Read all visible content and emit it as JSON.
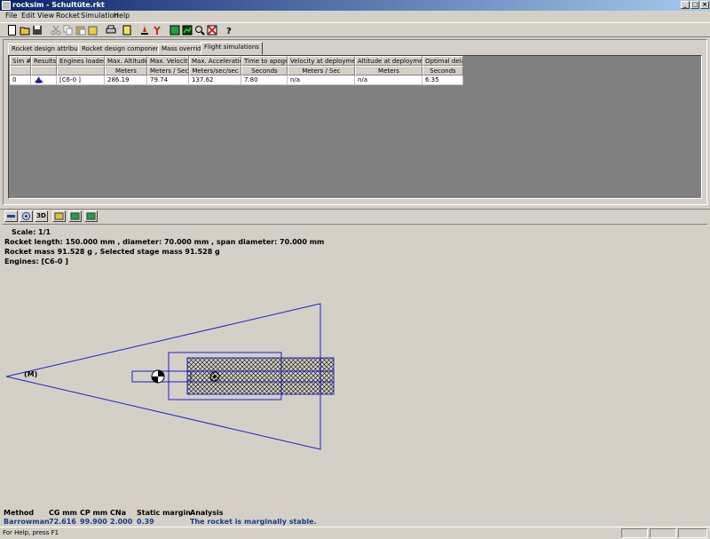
{
  "window": {
    "title": "rocksim - Schultüte.rkt"
  },
  "menu": [
    "File",
    "Edit",
    "View",
    "Rocket",
    "Simulation",
    "Help"
  ],
  "toolbar": {
    "buttons": [
      "new-icon",
      "open-icon",
      "save-icon",
      "cut-icon",
      "copy-icon",
      "paste-icon",
      "paste-special-icon",
      "print-icon",
      "properties-icon",
      "launch-icon",
      "engine-icon",
      "grid-icon",
      "chart-icon",
      "zoom-icon",
      "cancel-icon",
      "help-icon"
    ]
  },
  "tabs": [
    "Rocket design attributes",
    "Rocket design components",
    "Mass override",
    "Flight simulations"
  ],
  "active_tab": "Flight simulations",
  "table": {
    "headers": [
      "Sim #",
      "Results",
      "Engines loaded",
      "Max. Altitude",
      "Max. Velocity",
      "Max. Acceleration",
      "Time to apogee",
      "Velocity at deployment",
      "Altitude at deployment",
      "Optimal delay"
    ],
    "units": [
      "",
      "",
      "",
      "Meters",
      "Meters / Sec",
      "Meters/sec/sec",
      "Seconds",
      "Meters / Sec",
      "Meters",
      "Seconds"
    ],
    "rows": [
      [
        "0",
        "",
        "[C6-0   ]",
        "286.19",
        "79.74",
        "137.62",
        "7.80",
        "n/a",
        "n/a",
        "6.35"
      ]
    ]
  },
  "design_toolbar": {
    "labels": [
      "",
      "",
      "3D",
      "",
      "",
      ""
    ]
  },
  "design_info": {
    "scale": "Scale: 1/1",
    "length_line": "Rocket length: 150.000  mm , diameter: 70.000  mm , span diameter: 70.000  mm",
    "mass_line": "Rocket mass 91.528 g , Selected stage mass 91.528 g",
    "engines_line": "Engines: [C6-0   ]",
    "marker_label": "(M)"
  },
  "stability": {
    "headers": [
      "Method",
      "CG mm",
      "CP mm",
      "CNa",
      "Static margin",
      "Analysis"
    ],
    "values": [
      "Barrowman",
      "72.616",
      "99.900",
      "2.000",
      "0.39",
      "The rocket is marginally stable."
    ]
  },
  "status": {
    "text": "For Help, press F1"
  },
  "colors": {
    "outline": "#2020c0",
    "panel": "#d4d0c8",
    "grid_bg": "#808080",
    "title_start": "#0a246a",
    "title_end": "#a6caf0"
  }
}
